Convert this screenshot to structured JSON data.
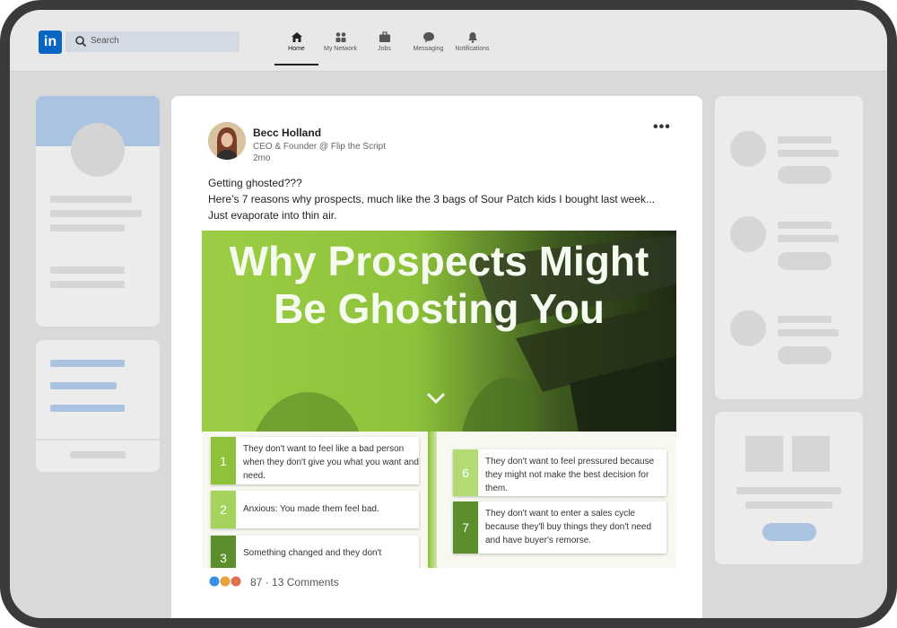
{
  "nav": {
    "logo": "in",
    "search_placeholder": "Search",
    "items": [
      {
        "label": "Home"
      },
      {
        "label": "My Network"
      },
      {
        "label": "Jobs"
      },
      {
        "label": "Messaging"
      },
      {
        "label": "Notifications"
      }
    ]
  },
  "post": {
    "author": "Becc Holland",
    "headline": "CEO & Founder @ Flip the Script",
    "time": "2mo",
    "text_line1": "Getting ghosted???",
    "text_line2": "Here’s 7 reasons why prospects, much like the 3 bags of Sour Patch kids I bought last week... Just evaporate into thin air.",
    "image_title": "Why Prospects Might Be Ghosting You",
    "reasons_left": [
      {
        "num": "1",
        "text": "They don't want to feel like a bad person when they don't give you what you want and need."
      },
      {
        "num": "2",
        "text": "Anxious: You made them feel bad."
      },
      {
        "num": "3",
        "text": "Something changed and they don't"
      }
    ],
    "reasons_right": [
      {
        "num": "6",
        "text": "They don't want to feel pressured because they might not make the best decision for them."
      },
      {
        "num": "7",
        "text": "They don't want to enter a sales cycle because they'll buy things they don't need and have buyer's remorse."
      }
    ],
    "reaction_count": "87",
    "comments": "13 Comments",
    "separator": "·"
  },
  "colors": {
    "brand": "#0a66c2",
    "green_light": "#9ccd45",
    "green_dark": "#5a8f2c"
  }
}
